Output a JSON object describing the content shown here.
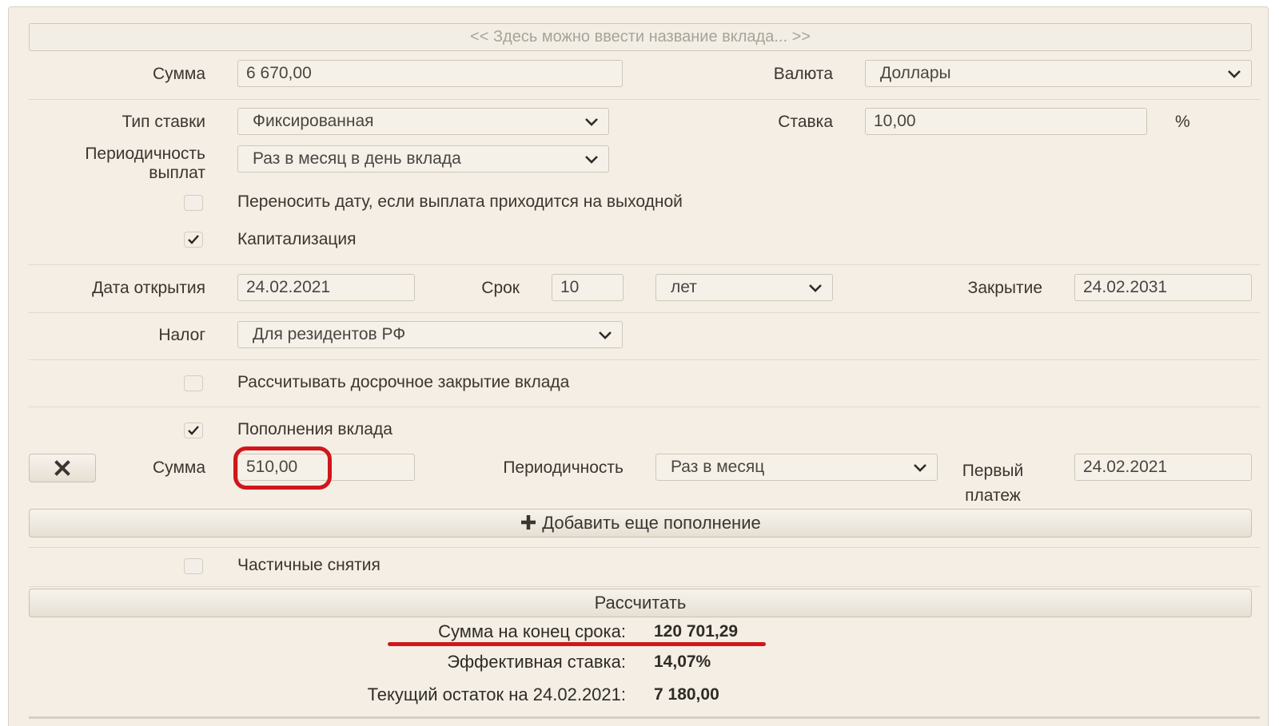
{
  "deposit_name": {
    "placeholder": "<< Здесь можно ввести название вклада... >>"
  },
  "amount": {
    "label": "Сумма",
    "value": "6 670,00"
  },
  "currency": {
    "label": "Валюта",
    "value": "Доллары"
  },
  "rate_type": {
    "label": "Тип ставки",
    "value": "Фиксированная"
  },
  "rate": {
    "label": "Ставка",
    "value": "10,00",
    "unit": "%"
  },
  "payout_period": {
    "label_line1": "Периодичность",
    "label_line2": "выплат",
    "value": "Раз в месяц в день вклада"
  },
  "move_date": {
    "checked": false,
    "label": "Переносить дату, если выплата приходится на выходной"
  },
  "capitalization": {
    "checked": true,
    "label": "Капитализация"
  },
  "open_date": {
    "label": "Дата открытия",
    "value": "24.02.2021"
  },
  "term": {
    "label": "Срок",
    "value": "10",
    "unit": "лет"
  },
  "close_date": {
    "label": "Закрытие",
    "value": "24.02.2031"
  },
  "tax": {
    "label": "Налог",
    "value": "Для резидентов РФ"
  },
  "early_close": {
    "checked": false,
    "label": "Рассчитывать досрочное закрытие вклада"
  },
  "replenishment": {
    "checked": true,
    "label": "Пополнения вклада",
    "remove_icon": "close-x-icon",
    "amount_label": "Сумма",
    "amount_value": "510,00",
    "period_label": "Периодичность",
    "period_value": "Раз в месяц",
    "first_payment_label_line1": "Первый",
    "first_payment_label_line2": "платеж",
    "first_payment_value": "24.02.2021",
    "add_button": "Добавить еще пополнение"
  },
  "partial_withdrawals": {
    "checked": false,
    "label": "Частичные снятия"
  },
  "calculate_button": "Рассчитать",
  "results": {
    "final_sum_label": "Сумма на конец срока:",
    "final_sum_value": "120 701,29",
    "effective_rate_label": "Эффективная ставка:",
    "effective_rate_value": "14,07%",
    "current_balance_label": "Текущий остаток на 24.02.2021:",
    "current_balance_value": "7 180,00"
  },
  "annotation_color": "#d0161c"
}
